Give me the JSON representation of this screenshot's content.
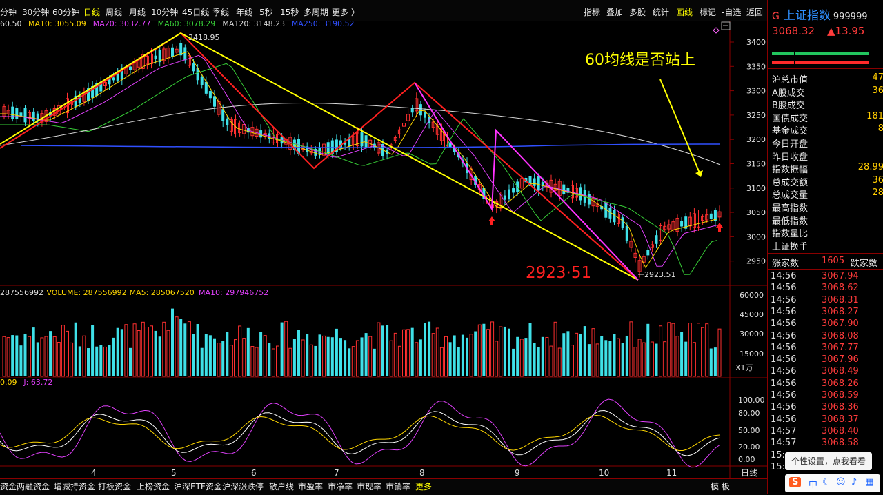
{
  "topbar": {
    "left_items": [
      {
        "label": "分钟"
      },
      {
        "label": "30分钟"
      },
      {
        "label": "60分钟"
      },
      {
        "label": "日线"
      },
      {
        "label": "周线"
      },
      {
        "label": "月线"
      },
      {
        "label": "10分钟"
      },
      {
        "label": "45日线"
      },
      {
        "label": "季线"
      },
      {
        "label": "年线"
      },
      {
        "label": "5秒"
      },
      {
        "label": "15秒"
      },
      {
        "label": "多周期"
      },
      {
        "label": "更多 〉"
      }
    ],
    "active": "日线",
    "right_items": [
      {
        "label": "指标"
      },
      {
        "label": "叠加"
      },
      {
        "label": "多股"
      },
      {
        "label": "统计"
      },
      {
        "label": "画线"
      },
      {
        "label": "标记"
      },
      {
        "label": "-自选"
      },
      {
        "label": "返回"
      }
    ],
    "right_active": "画线"
  },
  "ma_legend": [
    {
      "text": "60.50",
      "color": "#e0e0e0"
    },
    {
      "text": "MA10: 3055.09",
      "color": "#ffd700"
    },
    {
      "text": "MA20: 3032.77",
      "color": "#e040fb"
    },
    {
      "text": "MA60: 3078.29",
      "color": "#38d038"
    },
    {
      "text": "MA120: 3148.23",
      "color": "#d8d8d8"
    },
    {
      "text": "MA250: 3190.52",
      "color": "#3050ff"
    }
  ],
  "annotations": {
    "high_label": "3418.95",
    "low_label": "2923.51",
    "low_big": "2923·51",
    "note": "60均线是否站上"
  },
  "price_axis": [
    "3400",
    "3350",
    "3300",
    "3250",
    "3200",
    "3150",
    "3100",
    "3050",
    "3000",
    "2950"
  ],
  "volume_legend": [
    {
      "text": "287556992",
      "color": "#e0e0e0"
    },
    {
      "text": "VOLUME: 287556992",
      "color": "#ffd700"
    },
    {
      "text": "MA5: 285067520",
      "color": "#ffd700"
    },
    {
      "text": "MA10: 297946752",
      "color": "#e040fb"
    }
  ],
  "volume_axis": [
    "60000",
    "45000",
    "30000",
    "15000",
    "X1万"
  ],
  "kdj_legend": [
    {
      "text": "0.09",
      "color": "#ffd700"
    },
    {
      "text": "J: 63.72",
      "color": "#e040fb"
    }
  ],
  "kdj_axis": [
    "100.00",
    "80.00",
    "50.00",
    "20.00",
    "0.00"
  ],
  "months": [
    "4",
    "5",
    "6",
    "7",
    "8",
    "9",
    "10",
    "11"
  ],
  "period_label": "日线",
  "bottombar": {
    "items": [
      "资金",
      "两融资金",
      "增减持资金",
      "打板资金",
      "上榜资金",
      "沪深ETF资金",
      "沪深涨跌停",
      "散户线",
      "市盈率",
      "市净率",
      "市现率",
      "市销率",
      "更多"
    ],
    "right": "模 板"
  },
  "sidebar": {
    "g": "G",
    "name": "上证指数",
    "code": "999999",
    "price": "3068.32",
    "change": "▲13.95",
    "stats": [
      {
        "label": "沪总市值",
        "value": "47"
      },
      {
        "label": "A股成交",
        "value": "36"
      },
      {
        "label": "B股成交",
        "value": ""
      },
      {
        "label": "国债成交",
        "value": "181"
      },
      {
        "label": "基金成交",
        "value": "8"
      },
      {
        "label": "今日开盘",
        "value": ""
      },
      {
        "label": "昨日收盘",
        "value": ""
      },
      {
        "label": "指数振幅",
        "value": "28.99"
      },
      {
        "label": "总成交额",
        "value": "36"
      },
      {
        "label": "总成交量",
        "value": "28"
      },
      {
        "label": "最高指数",
        "value": ""
      },
      {
        "label": "最低指数",
        "value": ""
      },
      {
        "label": "指数量比",
        "value": ""
      },
      {
        "label": "上证换手",
        "value": ""
      }
    ],
    "rise_label": "涨家数",
    "rise_value": "1605",
    "fall_label": "跌家数",
    "ticks": [
      {
        "t": "14:56",
        "p": "3067.94"
      },
      {
        "t": "14:56",
        "p": "3068.62"
      },
      {
        "t": "14:56",
        "p": "3068.31"
      },
      {
        "t": "14:56",
        "p": "3068.27"
      },
      {
        "t": "14:56",
        "p": "3067.90"
      },
      {
        "t": "14:56",
        "p": "3068.08"
      },
      {
        "t": "14:56",
        "p": "3067.77"
      },
      {
        "t": "14:56",
        "p": "3067.96"
      },
      {
        "t": "14:56",
        "p": "3068.49"
      },
      {
        "t": "14:56",
        "p": "3068.26"
      },
      {
        "t": "14:56",
        "p": "3068.59"
      },
      {
        "t": "14:56",
        "p": "3068.36"
      },
      {
        "t": "14:56",
        "p": "3068.37"
      },
      {
        "t": "14:57",
        "p": "3068.40"
      },
      {
        "t": "14:57",
        "p": "3068.58"
      },
      {
        "t": "15:",
        "p": ""
      },
      {
        "t": "15:",
        "p": ""
      }
    ]
  },
  "popup": "个性设置，点我看看",
  "ime": {
    "logo": "S",
    "mode": "中"
  }
}
